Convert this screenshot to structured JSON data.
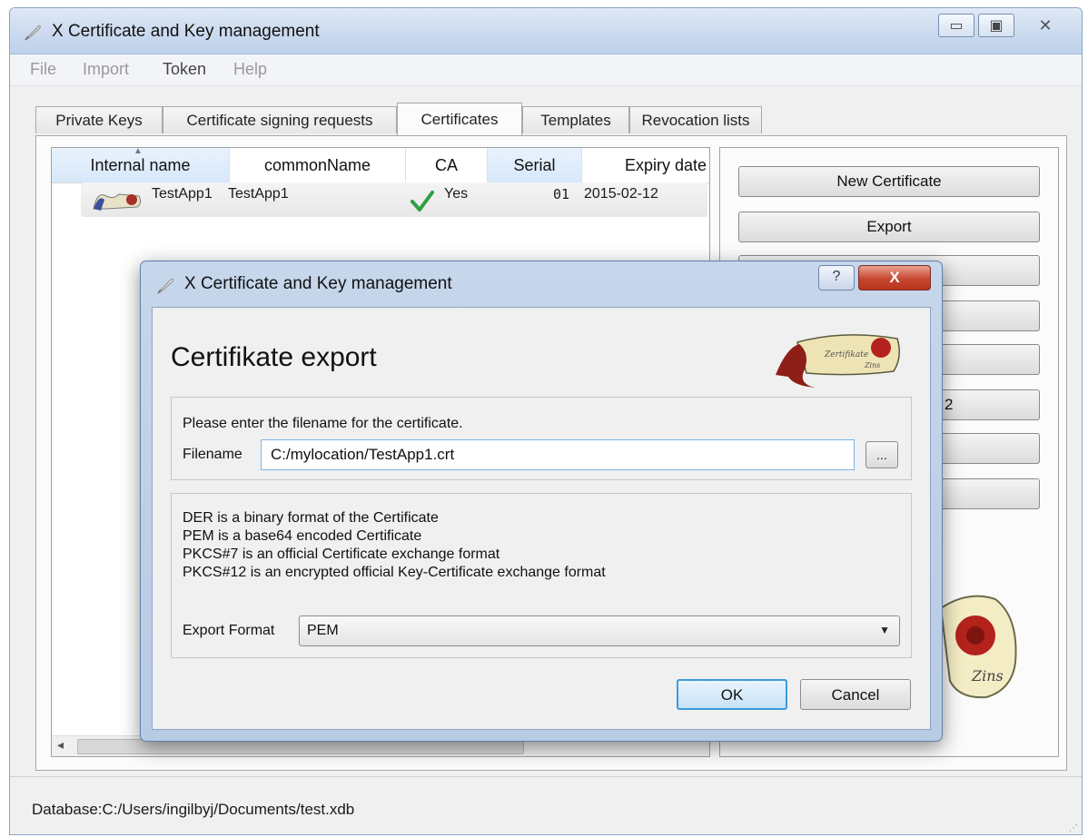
{
  "window": {
    "title": "X Certificate and Key management",
    "caption": {
      "minimize": "▭",
      "maximize": "▣",
      "close": "✕"
    }
  },
  "menu": {
    "items": [
      {
        "label": "File",
        "enabled": false
      },
      {
        "label": "Import",
        "enabled": false
      },
      {
        "label": "Token",
        "enabled": true
      },
      {
        "label": "Help",
        "enabled": false
      }
    ]
  },
  "tabs": [
    {
      "label": "Private Keys"
    },
    {
      "label": "Certificate signing requests"
    },
    {
      "label": "Certificates"
    },
    {
      "label": "Templates"
    },
    {
      "label": "Revocation lists"
    }
  ],
  "table": {
    "columns": [
      "Internal name",
      "commonName",
      "CA",
      "Serial",
      "Expiry date"
    ],
    "rows": [
      {
        "internal_name": "TestApp1",
        "common_name": "TestApp1",
        "ca": "Yes",
        "serial": "01",
        "expiry": "2015-02-12"
      }
    ]
  },
  "side_buttons": {
    "new_certificate": "New Certificate",
    "export": "Export",
    "partial_2": "2"
  },
  "status": {
    "database": "Database:C:/Users/ingilbyj/Documents/test.xdb"
  },
  "dialog": {
    "title": "X Certificate and Key management",
    "help": "?",
    "close": "X",
    "heading": "Certifikate export",
    "filename_prompt": "Please enter the filename for the certificate.",
    "filename_label": "Filename",
    "filename_value": "C:/mylocation/TestApp1.crt",
    "browse": "...",
    "format_info": [
      "DER is a binary format of the Certificate",
      "PEM is a base64 encoded Certificate",
      "PKCS#7 is an official Certificate exchange format",
      "PKCS#12 is an encrypted official Key-Certificate exchange format"
    ],
    "export_format_label": "Export Format",
    "export_format_value": "PEM",
    "ok": "OK",
    "cancel": "Cancel"
  },
  "colors": {
    "accent_blue": "#3c9bd6",
    "close_red": "#c7472f",
    "check_green": "#2ea043"
  },
  "icons": [
    "app-feather-icon",
    "certificate-row-icon",
    "check-icon",
    "logo-scroll-icon",
    "seal-icon"
  ]
}
